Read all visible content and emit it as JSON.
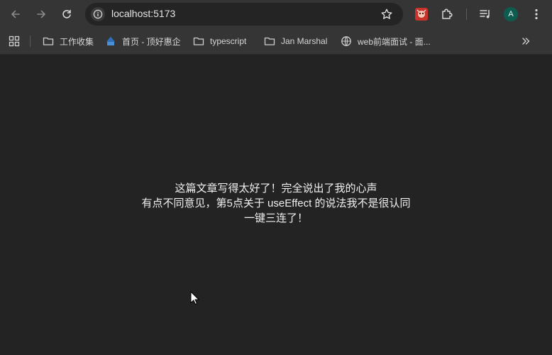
{
  "browser": {
    "url": "localhost:5173",
    "profile_initial": "A",
    "colors": {
      "toolbar": "#353535",
      "content_bg": "#232323",
      "avatar": "#0e5c50"
    }
  },
  "toolbar": {
    "icons": [
      "back-icon",
      "forward-icon",
      "reload-icon",
      "site-info-icon",
      "bookmark-star-icon",
      "extension-red-icon",
      "extensions-puzzle-icon",
      "media-controls-icon",
      "profile-avatar",
      "more-menu-icon"
    ]
  },
  "bookmarks": {
    "items": [
      {
        "label": "工作收集",
        "icon": "folder-icon"
      },
      {
        "label": "首页 - 顶好惠企",
        "icon": "site-favicon"
      },
      {
        "label": "typescript",
        "icon": "folder-icon"
      },
      {
        "label": "Jan Marshal",
        "icon": "folder-icon"
      },
      {
        "label": "web前端面试 - 面...",
        "icon": "globe-icon"
      }
    ]
  },
  "content": {
    "lines": [
      "这篇文章写得太好了！完全说出了我的心声",
      "有点不同意见，第5点关于 useEffect 的说法我不是很认同",
      "一键三连了！"
    ]
  }
}
